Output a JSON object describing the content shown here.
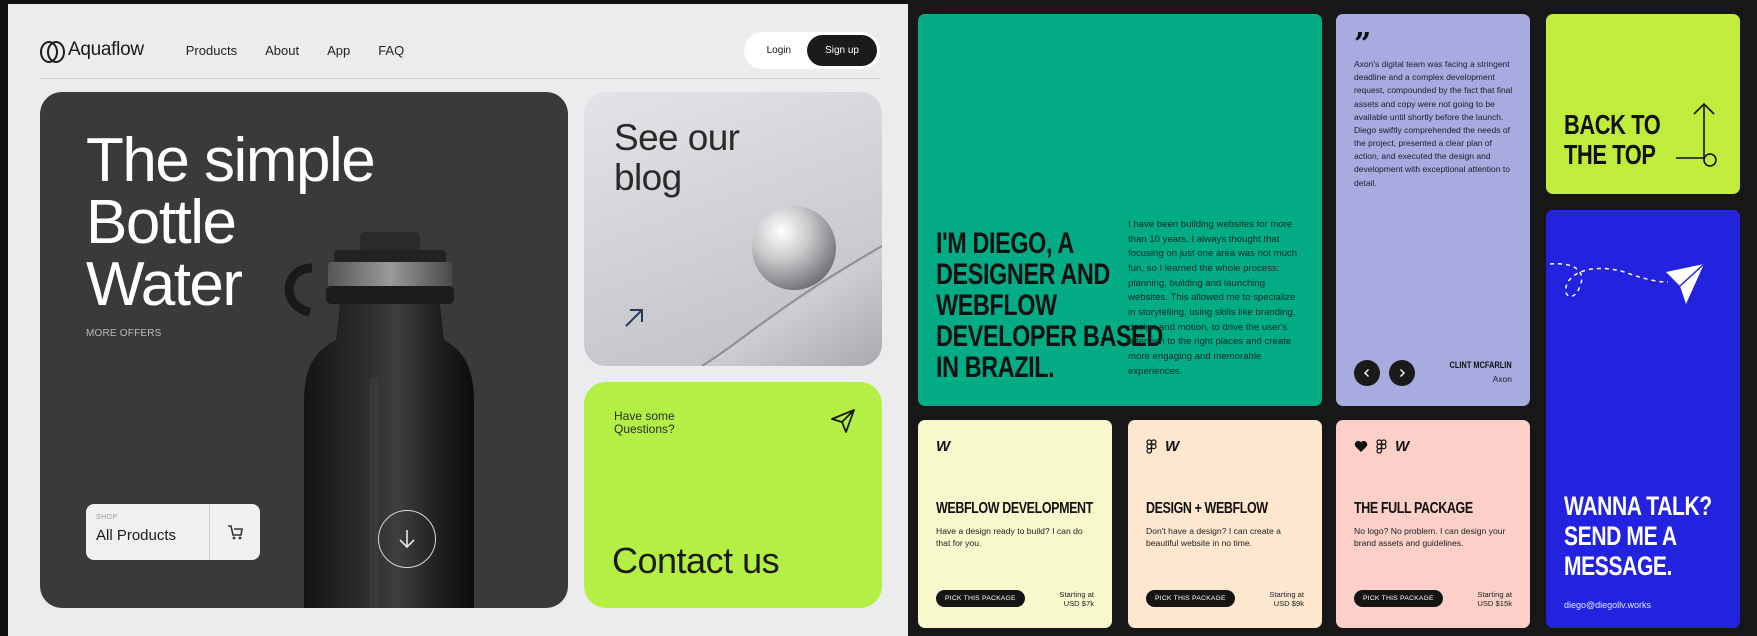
{
  "left": {
    "brand": "Aquaflow",
    "nav": [
      "Products",
      "About",
      "App",
      "FAQ"
    ],
    "login": "Login",
    "signup": "Sign up",
    "hero": {
      "title_lines": [
        "The simple",
        "Bottle",
        "Water"
      ],
      "more_offers": "MORE OFFERS",
      "shop_label": "SHOP",
      "shop_value": "All Products"
    },
    "blog": {
      "title_lines": [
        "See our",
        "blog"
      ]
    },
    "contact": {
      "question": "Have some Questions?",
      "title": "Contact us"
    }
  },
  "right": {
    "intro": {
      "title_lines": [
        "I'M DIEGO, A",
        "DESIGNER AND",
        "WEBFLOW",
        "DEVELOPER BASED",
        "IN BRAZIL."
      ],
      "body": "I have been building websites for more than 10 years. I always thought that focusing on just one area was not much fun, so I learned the whole process: planning, building and launching websites. This allowed me to specialize in storytelling, using skills like branding, design and motion, to drive the user's attention to the right places and create more engaging and memorable experiences."
    },
    "testimonial": {
      "quote": "Axon's digital team was facing a stringent deadline and a complex development request, compounded by the fact that final assets and copy were not going to be available until shortly before the launch. Diego swiftly comprehended the needs of the project, presented a clear plan of action, and executed the design and development with exceptional attention to detail.",
      "author": "CLINT MCFARLIN",
      "company": "Axon"
    },
    "back_to_top": [
      "BACK TO",
      "THE TOP"
    ],
    "talk": {
      "title_lines": [
        "WANNA TALK?",
        "SEND ME A",
        "MESSAGE."
      ],
      "email": "diego@diegollv.works"
    },
    "packages": [
      {
        "title": "WEBFLOW DEVELOPMENT",
        "desc": "Have a design ready to build? I can do that for you.",
        "button": "PICK THIS PACKAGE",
        "price_label": "Starting at",
        "price": "USD $7k"
      },
      {
        "title": "DESIGN + WEBFLOW",
        "desc": "Don't have a design? I can create a beautiful website in no time.",
        "button": "PICK THIS PACKAGE",
        "price_label": "Starting at",
        "price": "USD $9k"
      },
      {
        "title": "THE FULL PACKAGE",
        "desc": "No logo? No problem. I can design your brand assets and guidelines.",
        "button": "PICK THIS PACKAGE",
        "price_label": "Starting at",
        "price": "USD $15k"
      }
    ],
    "colors": {
      "intro": "#04ac86",
      "testimonial": "#a7abe0",
      "back_to_top": "#c0ec3b",
      "talk": "#2323df",
      "package_1": "#f7f9cc",
      "package_2": "#fde7cf",
      "package_3": "#fccfc9"
    }
  }
}
